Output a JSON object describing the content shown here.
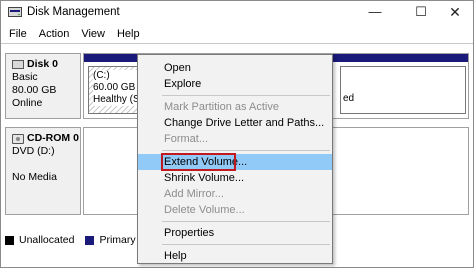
{
  "window": {
    "title": "Disk Management",
    "minimize_glyph": "—",
    "maximize_glyph": "☐",
    "close_glyph": "✕"
  },
  "menubar": {
    "items": [
      "File",
      "Action",
      "View",
      "Help"
    ]
  },
  "disks": {
    "disk0": {
      "name": "Disk 0",
      "type": "Basic",
      "size": "80.00 GB",
      "status": "Online"
    },
    "cdrom0": {
      "name": "CD-ROM 0",
      "type": "DVD (D:)",
      "status": "No Media"
    }
  },
  "partitions": {
    "c": {
      "label": "(C:)",
      "size": "60.00 GB NT",
      "status": "Healthy (Sys"
    },
    "right_fragment": "ed"
  },
  "legend": {
    "unallocated": "Unallocated",
    "primary": "Primary partiti"
  },
  "context_menu": {
    "items": [
      {
        "label": "Open",
        "enabled": true
      },
      {
        "label": "Explore",
        "enabled": true
      },
      {
        "label": "Mark Partition as Active",
        "enabled": false
      },
      {
        "label": "Change Drive Letter and Paths...",
        "enabled": true
      },
      {
        "label": "Format...",
        "enabled": false
      },
      {
        "label": "Extend Volume...",
        "enabled": true,
        "highlighted": true
      },
      {
        "label": "Shrink Volume...",
        "enabled": true
      },
      {
        "label": "Add Mirror...",
        "enabled": false
      },
      {
        "label": "Delete Volume...",
        "enabled": false
      },
      {
        "label": "Properties",
        "enabled": true
      },
      {
        "label": "Help",
        "enabled": true
      }
    ]
  },
  "colors": {
    "primary_partition": "#1a1a7a",
    "unallocated": "#000000",
    "menu_highlight": "#91c9f7",
    "annotation_box": "#c0191f"
  }
}
